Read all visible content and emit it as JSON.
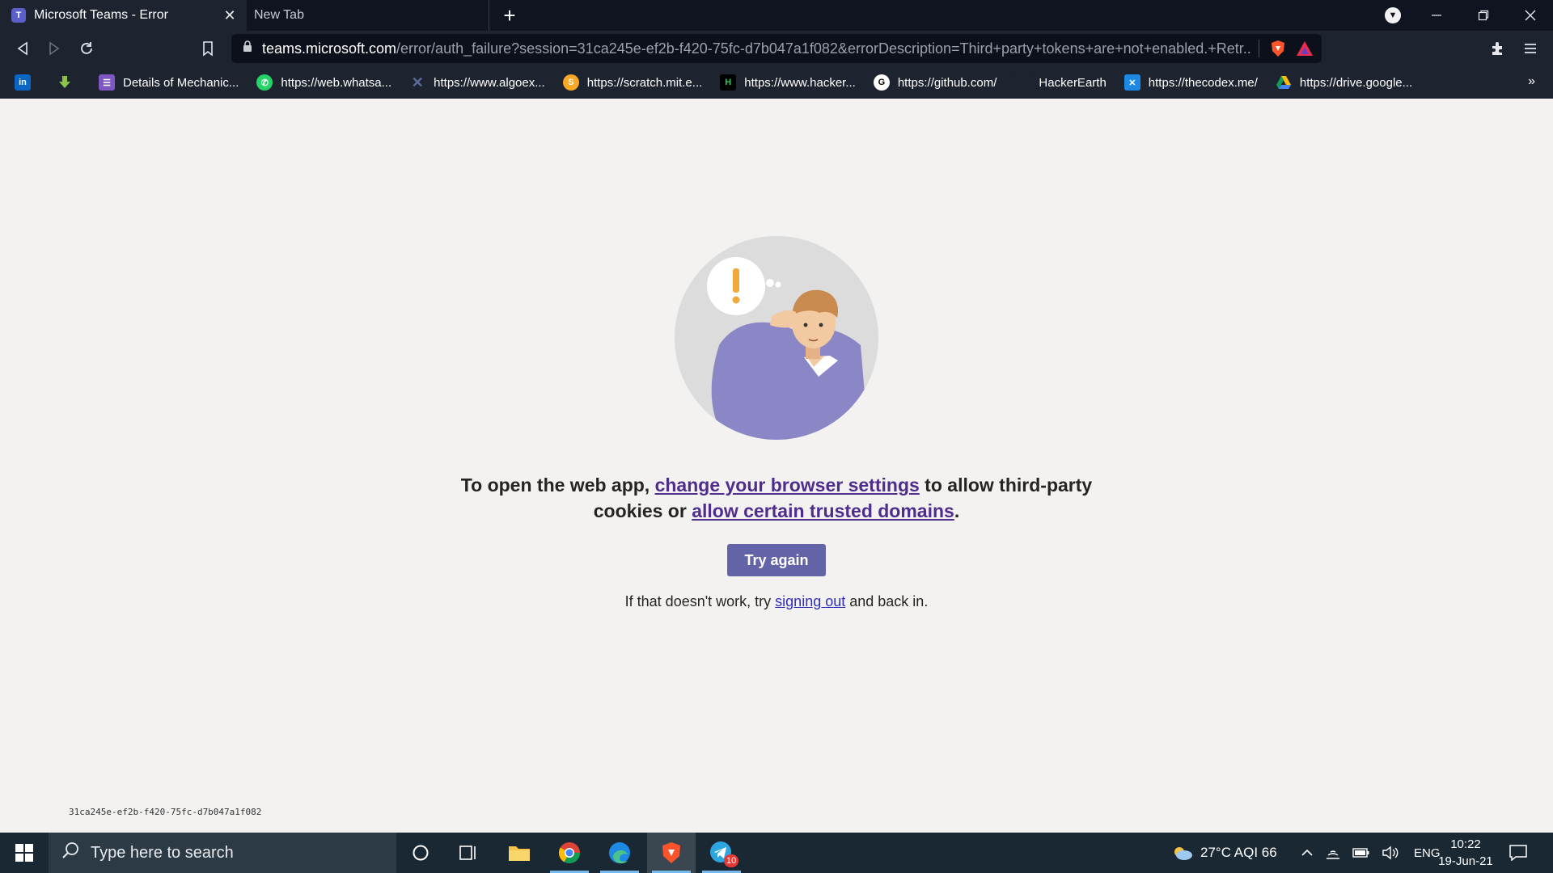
{
  "browser": {
    "tabs": [
      {
        "title": "Microsoft Teams - Error",
        "active": true
      },
      {
        "title": "New Tab",
        "active": false
      }
    ],
    "url": {
      "host": "teams.microsoft.com",
      "path": "/error/auth_failure?session=31ca245e-ef2b-f420-75fc-d7b047a1f082&errorDescription=Third+party+tokens+are+not+enabled.+Retr..."
    },
    "bookmarks": [
      {
        "label": "",
        "icon": "linkedin-icon"
      },
      {
        "label": "",
        "icon": "download-icon"
      },
      {
        "label": "Details of Mechanic...",
        "icon": "list-icon"
      },
      {
        "label": "https://web.whatsa...",
        "icon": "whatsapp-icon"
      },
      {
        "label": "https://www.algoex...",
        "icon": "algoexpert-icon"
      },
      {
        "label": "https://scratch.mit.e...",
        "icon": "scratch-icon"
      },
      {
        "label": "https://www.hacker...",
        "icon": "hackerrank-icon"
      },
      {
        "label": "https://github.com/",
        "icon": "github-icon"
      },
      {
        "label": "HackerEarth",
        "icon": "hackerearth-icon"
      },
      {
        "label": "https://thecodex.me/",
        "icon": "thecodex-icon"
      },
      {
        "label": "https://drive.google...",
        "icon": "google-drive-icon"
      }
    ],
    "bookmarks_more": "»"
  },
  "page": {
    "message": {
      "part1": "To open the web app, ",
      "link1": "change your browser settings",
      "part2": " to allow third-party cookies or ",
      "link2": "allow certain trusted domains",
      "part3": "."
    },
    "try_again_label": "Try again",
    "hint": {
      "before": "If that doesn't work, try ",
      "link": "signing out",
      "after": " and back in."
    },
    "session_id": "31ca245e-ef2b-f420-75fc-d7b047a1f082"
  },
  "taskbar": {
    "search_placeholder": "Type here to search",
    "weather": "27°C  AQI 66",
    "language": "ENG",
    "time": "10:22",
    "date": "19-Jun-21",
    "telegram_badge": "10"
  },
  "colors": {
    "teams_purple": "#6264a7",
    "link_purple": "#4f2d8d",
    "hint_link": "#2f2fbd",
    "page_bg": "#f3f2f1"
  }
}
